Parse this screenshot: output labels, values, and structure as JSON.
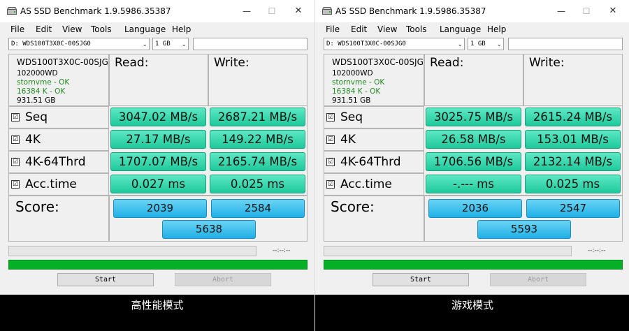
{
  "colors": {
    "value_box": "#2bd6a8",
    "score_box": "#2bb8ea",
    "progress_done": "#06b025",
    "ok_text": "#228b22"
  },
  "icons": [
    "drive-icon",
    "minimize-icon",
    "maximize-icon",
    "close-icon",
    "checkbox-checked-icon",
    "dropdown-arrow-icon"
  ],
  "window_controls": {
    "minimize": "—",
    "maximize": "☐",
    "close": "✕"
  },
  "checkmark": "☑",
  "dropdown_arrow": "⌄",
  "panels": [
    {
      "title": "AS SSD Benchmark 1.9.5986.35387",
      "menu": [
        "File",
        "Edit",
        "View",
        "Tools",
        "Language",
        "Help"
      ],
      "drive_select": "D: WDS100T3X0C-00SJG0",
      "size_select": "1 GB",
      "name_input": "",
      "info": {
        "model": "WDS100T3X0C-00SJG",
        "firmware": "102000WD",
        "driver": "stornvme - OK",
        "alignment": "16384 K - OK",
        "capacity": "931.51 GB"
      },
      "read_header": "Read:",
      "write_header": "Write:",
      "rows": [
        {
          "label": "Seq",
          "read": "3047.02 MB/s",
          "write": "2687.21 MB/s"
        },
        {
          "label": "4K",
          "read": "27.17 MB/s",
          "write": "149.22 MB/s"
        },
        {
          "label": "4K-64Thrd",
          "read": "1707.07 MB/s",
          "write": "2165.74 MB/s"
        },
        {
          "label": "Acc.time",
          "read": "0.027 ms",
          "write": "0.025 ms"
        }
      ],
      "score_label": "Score:",
      "score_read": "2039",
      "score_write": "2584",
      "score_total": "5638",
      "progress": 0,
      "elapsed": "--:--:--",
      "start_button": "Start",
      "abort_button": "Abort",
      "caption": "高性能模式"
    },
    {
      "title": "AS SSD Benchmark 1.9.5986.35387",
      "menu": [
        "File",
        "Edit",
        "View",
        "Tools",
        "Language",
        "Help"
      ],
      "drive_select": "D: WDS100T3X0C-00SJG0",
      "size_select": "1 GB",
      "name_input": "",
      "info": {
        "model": "WDS100T3X0C-00SJG",
        "firmware": "102000WD",
        "driver": "stornvme - OK",
        "alignment": "16384 K - OK",
        "capacity": "931.51 GB"
      },
      "read_header": "Read:",
      "write_header": "Write:",
      "rows": [
        {
          "label": "Seq",
          "read": "3025.75 MB/s",
          "write": "2615.24 MB/s"
        },
        {
          "label": "4K",
          "read": "26.58 MB/s",
          "write": "153.01 MB/s"
        },
        {
          "label": "4K-64Thrd",
          "read": "1706.56 MB/s",
          "write": "2132.14 MB/s"
        },
        {
          "label": "Acc.time",
          "read": "-.--- ms",
          "write": "0.025 ms"
        }
      ],
      "score_label": "Score:",
      "score_read": "2036",
      "score_write": "2547",
      "score_total": "5593",
      "progress": 0,
      "elapsed": "--:--:--",
      "start_button": "Start",
      "abort_button": "Abort",
      "caption": "游戏模式"
    }
  ]
}
